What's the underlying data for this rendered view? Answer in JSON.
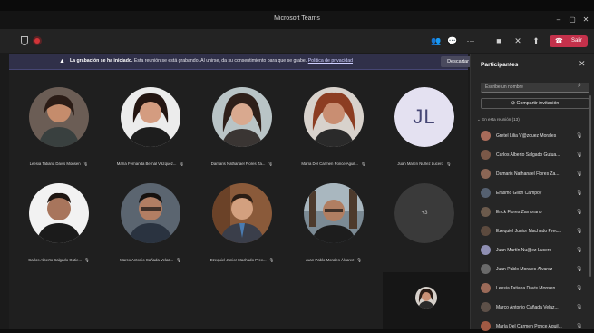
{
  "window": {
    "title": "Microsoft Teams"
  },
  "toolbar": {
    "leave_label": "Salir"
  },
  "banner": {
    "bold": "La grabación se ha iniciado.",
    "text": " Esta reunión se está grabando. Al unirse, da su consentimiento para que se grabe.",
    "link": "Política de privacidad",
    "dismiss": "Descartar"
  },
  "stage": {
    "tiles": [
      {
        "name": "Leesia Tatiana Davis Monsen"
      },
      {
        "name": "María Fernanda Bernal Vázquez..."
      },
      {
        "name": "Damaris Nathanael Flores Za..."
      },
      {
        "name": "María Del Carmen Ponce Aguil..."
      },
      {
        "name": "Juan Martín Nuñez Lucero",
        "initials": "JL"
      },
      {
        "name": "Carlos Alberto Salgado Gutie..."
      },
      {
        "name": "Marco Antonio Cañada Velaz..."
      },
      {
        "name": "Ezequiel Junior Machado Prec..."
      },
      {
        "name": "Juan Pablo Morales Álvarez"
      },
      {
        "more": "+3"
      }
    ]
  },
  "panel": {
    "title": "Participantes",
    "search_placeholder": "Escribe un nombre",
    "share_label": "Compartir invitación",
    "section": "En esta reunión (13)",
    "participants": [
      {
        "name": "Gretel Lilia V@zquez Morales",
        "color": "#a86b5a"
      },
      {
        "name": "Carlos Alberto Salgado Gutua...",
        "color": "#7a5848"
      },
      {
        "name": "Damaris Nathanael Flores Za...",
        "color": "#8b6655"
      },
      {
        "name": "Erasmo Glion Campoy",
        "color": "#556070"
      },
      {
        "name": "Erick Flores Zamorano",
        "color": "#6b5a4c"
      },
      {
        "name": "Ezequiel Junior Machado Prec...",
        "color": "#5c4a3e"
      },
      {
        "name": "Juan Martín Nu@ez Lucero",
        "color": "#8f8fb3"
      },
      {
        "name": "Juan Pablo Morales Álvarez",
        "color": "#6a6a6a"
      },
      {
        "name": "Leesia Tatiana Davis Monsen",
        "color": "#9b6a58"
      },
      {
        "name": "Marco Antonio Cañada Velaz...",
        "color": "#5d5048"
      },
      {
        "name": "María Del Carmen Ponce Aguil...",
        "color": "#a15a44"
      }
    ]
  }
}
